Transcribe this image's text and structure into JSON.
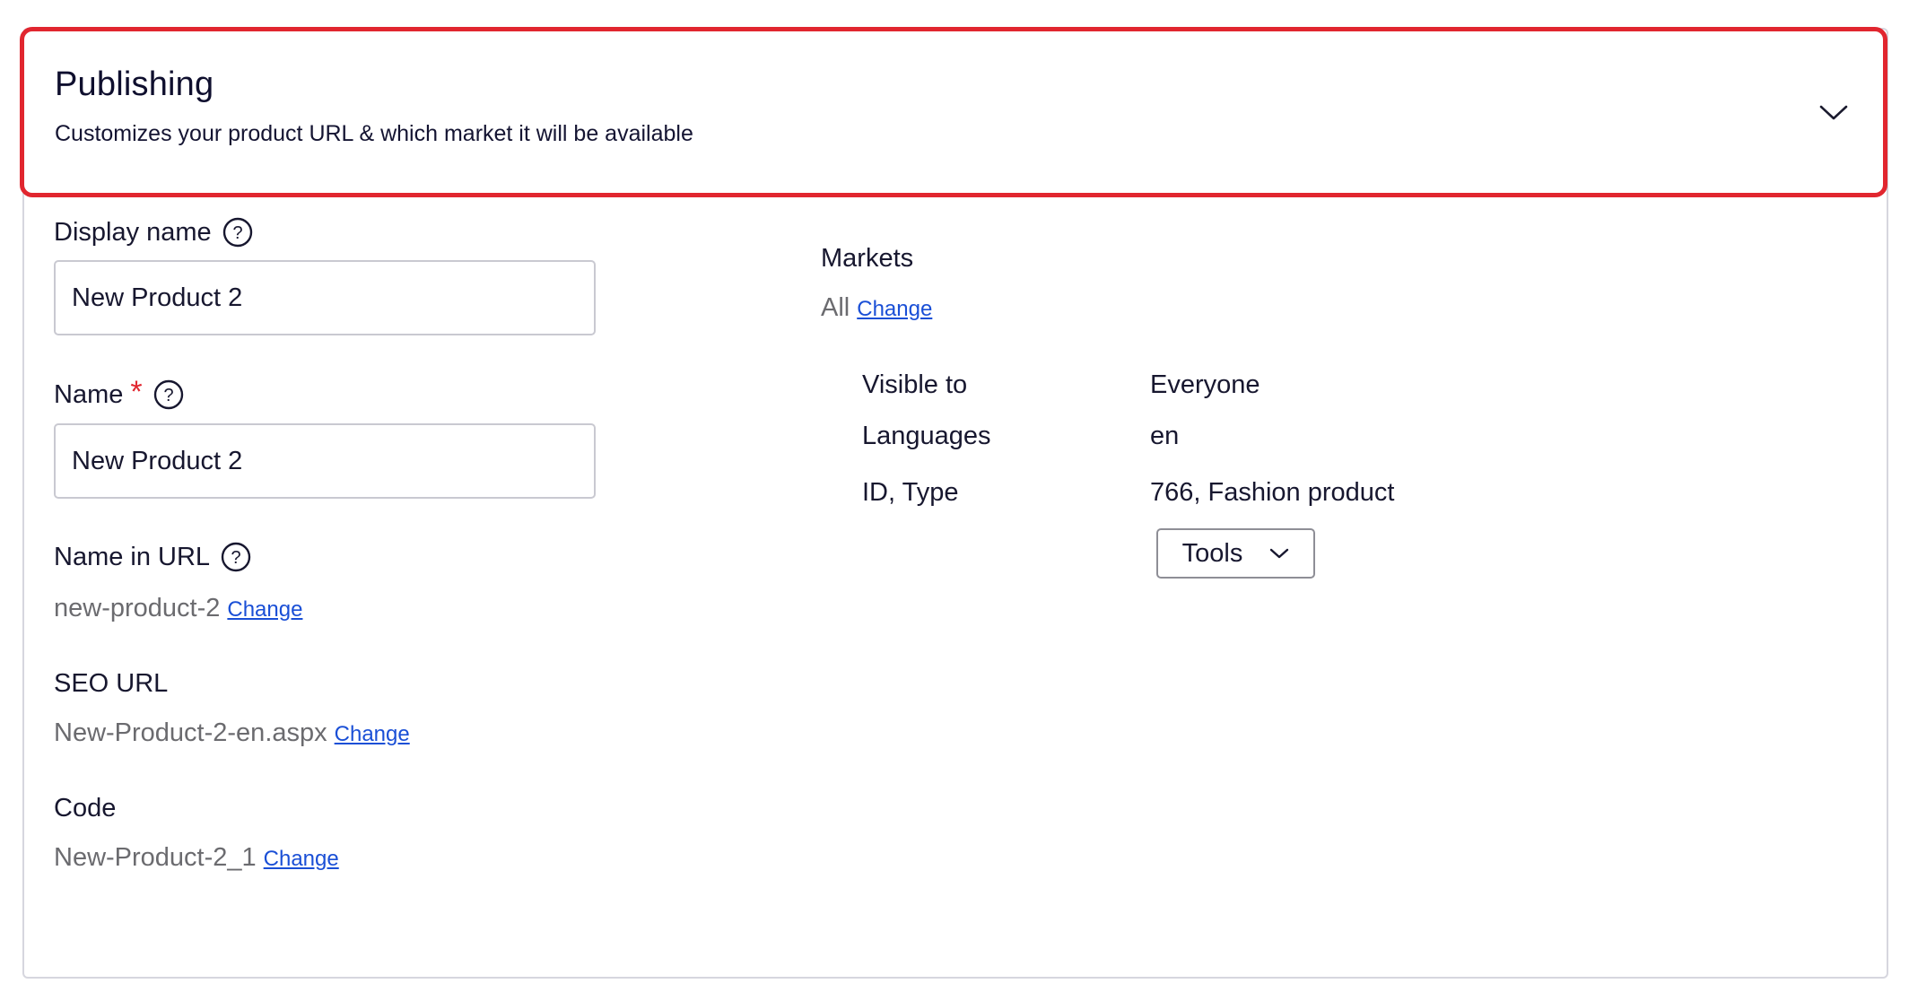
{
  "header": {
    "title": "Publishing",
    "subtitle": "Customizes your product URL & which market it will be available"
  },
  "fields": {
    "display_name": {
      "label": "Display name",
      "value": "New Product 2"
    },
    "name": {
      "label": "Name",
      "required_mark": "*",
      "value": "New Product 2"
    },
    "name_in_url": {
      "label": "Name in URL",
      "value": "new-product-2",
      "change_label": "Change"
    },
    "seo_url": {
      "label": "SEO URL",
      "value": "New-Product-2-en.aspx",
      "change_label": "Change"
    },
    "code": {
      "label": "Code",
      "value": "New-Product-2_1",
      "change_label": "Change"
    }
  },
  "markets": {
    "label": "Markets",
    "value": "All",
    "change_label": "Change"
  },
  "info": {
    "rows": [
      {
        "key": "Visible to",
        "value": "Everyone"
      },
      {
        "key": "Languages",
        "value": "en"
      },
      {
        "key": "ID, Type",
        "value": "766, Fashion product"
      }
    ]
  },
  "tools": {
    "label": "Tools"
  },
  "colors": {
    "highlight_border": "#e1262f",
    "link": "#1a4fd6",
    "required": "#e1262f"
  },
  "icons": {
    "collapse": "chevron-down-icon",
    "help": "question-circle-icon"
  }
}
